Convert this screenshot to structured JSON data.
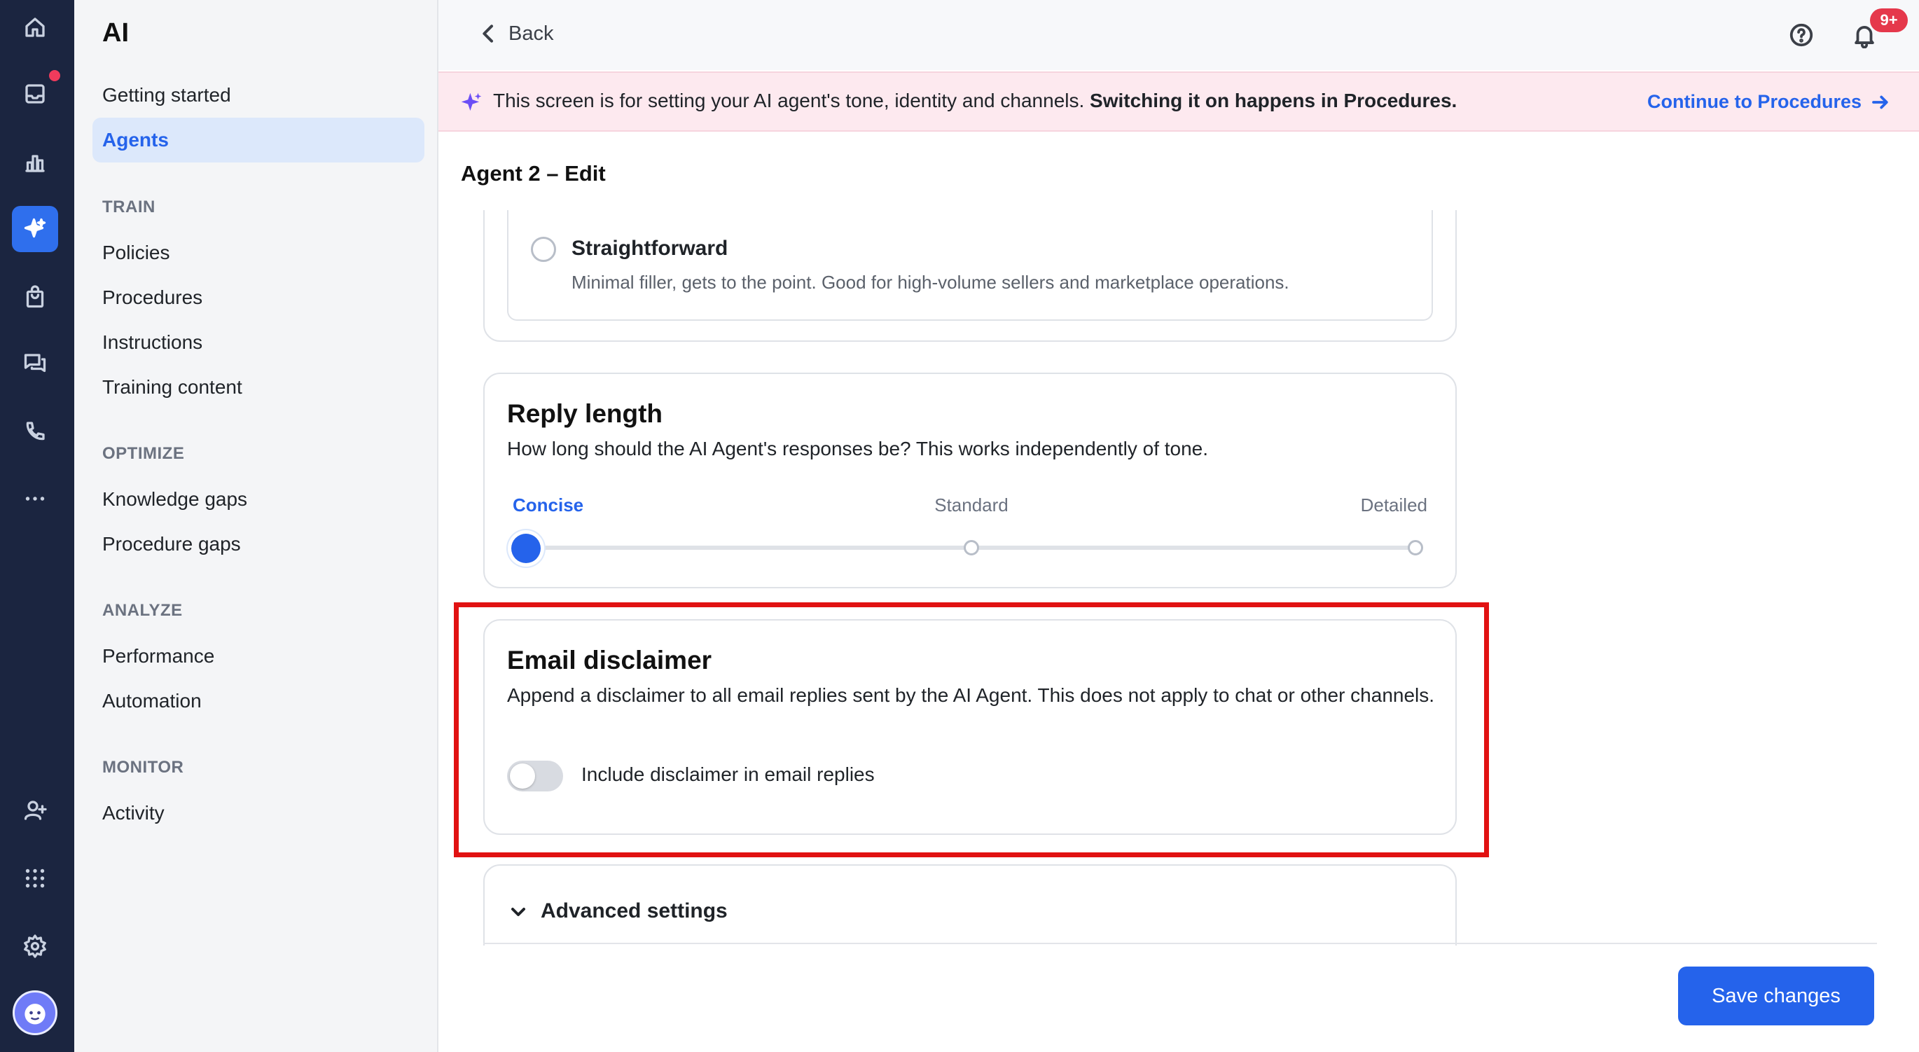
{
  "rail": {
    "items": [
      {
        "name": "home-icon"
      },
      {
        "name": "inbox-icon"
      },
      {
        "name": "analytics-icon"
      },
      {
        "name": "ai-sparkle-icon"
      },
      {
        "name": "shopping-bag-icon"
      },
      {
        "name": "chat-icon"
      },
      {
        "name": "phone-icon"
      },
      {
        "name": "more-icon"
      },
      {
        "name": "add-user-icon"
      },
      {
        "name": "apps-grid-icon"
      },
      {
        "name": "settings-icon"
      }
    ],
    "active_item": "ai-sparkle-icon",
    "accent_color": "#2f6fed",
    "notification_dot_color": "#ef3b5c"
  },
  "sidebar": {
    "title": "AI",
    "items": [
      {
        "label": "Getting started"
      },
      {
        "label": "Agents",
        "active": true
      }
    ],
    "sections": [
      {
        "heading": "TRAIN",
        "items": [
          "Policies",
          "Procedures",
          "Instructions",
          "Training content"
        ]
      },
      {
        "heading": "OPTIMIZE",
        "items": [
          "Knowledge gaps",
          "Procedure gaps"
        ]
      },
      {
        "heading": "ANALYZE",
        "items": [
          "Performance",
          "Automation"
        ]
      },
      {
        "heading": "MONITOR",
        "items": [
          "Activity"
        ]
      }
    ]
  },
  "topbar": {
    "back_label": "Back",
    "notification_badge": "9+"
  },
  "banner": {
    "text": "This screen is for setting your AI agent's tone, identity and channels. ",
    "bold_text": "Switching it on happens in Procedures.",
    "link_label": "Continue to Procedures"
  },
  "page": {
    "title": "Agent 2 – Edit"
  },
  "tone": {
    "option_name": "Straightforward",
    "option_desc": "Minimal filler, gets to the point. Good for high-volume sellers and marketplace operations.",
    "selected": false
  },
  "reply_length": {
    "title": "Reply length",
    "description": "How long should the AI Agent's responses be? This works independently of tone.",
    "options": [
      "Concise",
      "Standard",
      "Detailed"
    ],
    "selected": "Concise",
    "selected_index": 0
  },
  "email_disclaimer": {
    "title": "Email disclaimer",
    "description": "Append a disclaimer to all email replies sent by the AI Agent. This does not apply to chat or other channels.",
    "toggle_label": "Include disclaimer in email replies",
    "toggle_on": false
  },
  "advanced": {
    "label": "Advanced settings"
  },
  "footer": {
    "save_label": "Save changes"
  },
  "colors": {
    "primary": "#2563eb",
    "banner_bg": "#fde9ef",
    "highlight_border": "#e11212"
  }
}
